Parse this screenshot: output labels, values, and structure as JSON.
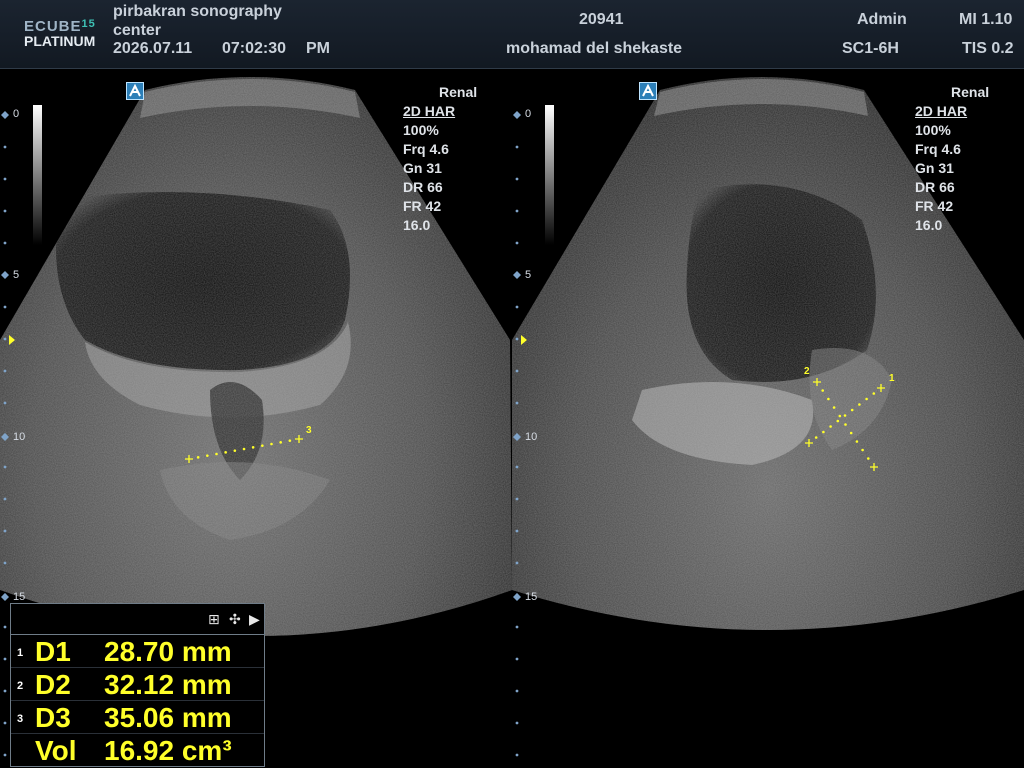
{
  "header": {
    "logo_line1": "ECUBE",
    "logo_version": "15",
    "logo_line2": "PLATINUM",
    "institution_line1": "pirbakran sonography",
    "institution_line2": "center",
    "date": "2026.07.11",
    "time": "07:02:30",
    "ampm": "PM",
    "patient_id": "20941",
    "patient_name": "mohamad del shekaste",
    "operator": "Admin",
    "probe": "SC1-6H",
    "mi": "MI 1.10",
    "tis": "TIS 0.2"
  },
  "left_image": {
    "preset": "Renal",
    "mode": "2D HAR",
    "power": "100%",
    "frequency": "Frq 4.6",
    "gain": "Gn 31",
    "dynamic_range": "DR 66",
    "frame_rate": "FR 42",
    "depth": "16.0",
    "depth_labels": [
      "0",
      "5",
      "10",
      "15"
    ],
    "caliper_label_3": "3"
  },
  "right_image": {
    "preset": "Renal",
    "mode": "2D HAR",
    "power": "100%",
    "frequency": "Frq 4.6",
    "gain": "Gn 31",
    "dynamic_range": "DR 66",
    "frame_rate": "FR 42",
    "depth": "16.0",
    "depth_labels": [
      "0",
      "5",
      "10",
      "15"
    ],
    "caliper_label_1": "1",
    "caliper_label_2": "2"
  },
  "measurements": [
    {
      "index": "1",
      "name": "D1",
      "value": "28.70 mm"
    },
    {
      "index": "2",
      "name": "D2",
      "value": "32.12 mm"
    },
    {
      "index": "3",
      "name": "D3",
      "value": "35.06 mm"
    },
    {
      "index": "",
      "name": "Vol",
      "value": "16.92 cm³"
    }
  ],
  "colors": {
    "caliper": "#ffff2a",
    "header_bg": "#1b2430",
    "active_indicator": "#7fc6e0"
  },
  "icons": [
    "probe-orientation-icon",
    "grid-icon",
    "move-icon",
    "play-arrow-icon"
  ]
}
